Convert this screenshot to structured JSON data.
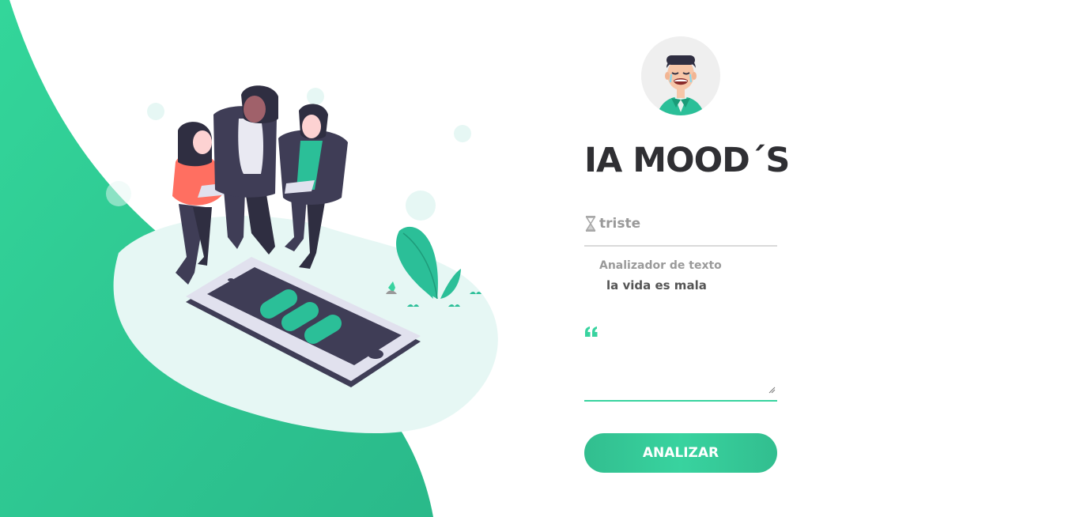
{
  "app": {
    "title": "IA MOOD´S"
  },
  "mood": {
    "icon": "hourglass-icon",
    "value": "triste"
  },
  "analyzer": {
    "label": "Analizador de texto",
    "text": "la vida es mala"
  },
  "input": {
    "icon": "quote-icon",
    "value": ""
  },
  "actions": {
    "analyze_label": "ANALIZAR"
  },
  "colors": {
    "accent": "#38d39f",
    "accent_dark": "#32be8f",
    "title": "#2f2f33",
    "muted": "#9a9a9a"
  }
}
